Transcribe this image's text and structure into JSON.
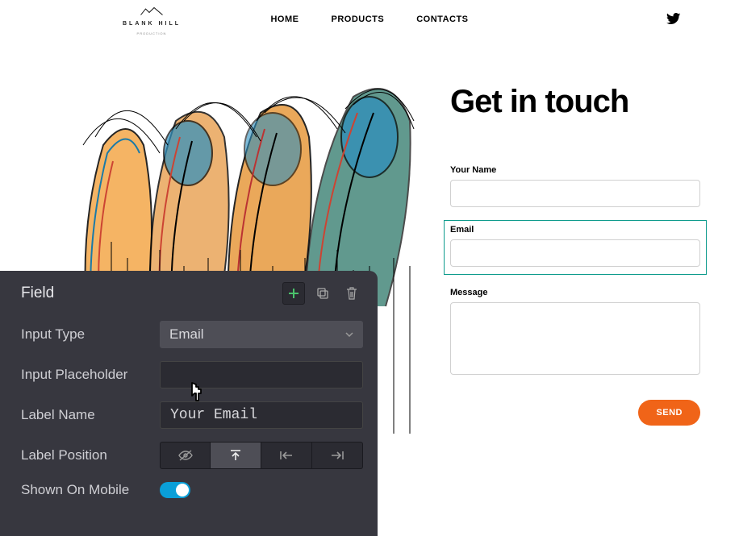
{
  "nav": {
    "brand": "BLANK HILL",
    "brand_sub": "PRODUCTION",
    "links": [
      "HOME",
      "PRODUCTS",
      "CONTACTS"
    ]
  },
  "contact": {
    "heading": "Get in touch",
    "name_label": "Your Name",
    "email_label": "Email",
    "message_label": "Message",
    "send_label": "SEND"
  },
  "editor": {
    "title": "Field",
    "input_type_label": "Input Type",
    "input_type_value": "Email",
    "placeholder_label": "Input Placeholder",
    "placeholder_value": "",
    "labelname_label": "Label Name",
    "labelname_value": "Your Email",
    "labelpos_label": "Label Position",
    "shown_mobile_label": "Shown On Mobile",
    "shown_mobile_value": true
  }
}
